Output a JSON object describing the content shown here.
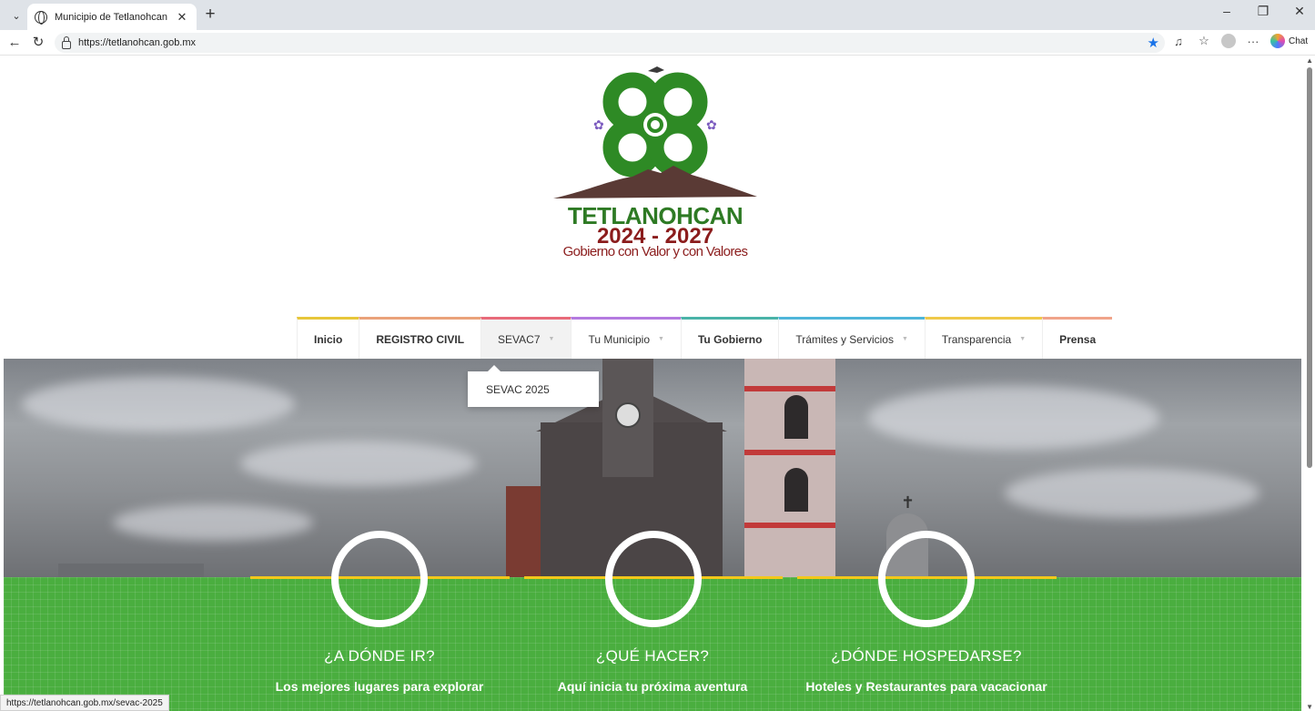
{
  "browser": {
    "tab_title": "Municipio de Tetlanohcan",
    "url": "https://tetlanohcan.gob.mx",
    "chat_label": "Chat",
    "status_url": "https://tetlanohcan.gob.mx/sevac-2025"
  },
  "logo": {
    "line1": "TETLANOHCAN",
    "line2": "2024 - 2027",
    "line3": "Gobierno con Valor y con Valores"
  },
  "menu": {
    "items": [
      {
        "label": "Inicio",
        "color": "#e7c63a"
      },
      {
        "label": "REGISTRO CIVIL",
        "color": "#eaa27a"
      },
      {
        "label": "SEVAC7",
        "color": "#e86a7a"
      },
      {
        "label": "Tu Municipio",
        "color": "#b47ae0"
      },
      {
        "label": "Tu Gobierno",
        "color": "#4ab3a8"
      },
      {
        "label": "Trámites y Servicios",
        "color": "#4fb6da"
      },
      {
        "label": "Transparencia",
        "color": "#efc94a"
      },
      {
        "label": "Prensa",
        "color": "#f0a48a"
      }
    ],
    "dropdown_item": "SEVAC 2025"
  },
  "features": [
    {
      "title": "¿A DÓNDE IR?",
      "subtitle": "Los mejores lugares para explorar"
    },
    {
      "title": "¿QUÉ HACER?",
      "subtitle": "Aquí inicia tu próxima aventura"
    },
    {
      "title": "¿DÓNDE HOSPEDARSE?",
      "subtitle": "Hoteles y Restaurantes para vacacionar"
    }
  ],
  "colors": {
    "logo_green": "#2e7a24",
    "logo_red": "#8b1c1c",
    "band_green": "#4aae3f",
    "accent_yellow": "#f2c81a"
  }
}
